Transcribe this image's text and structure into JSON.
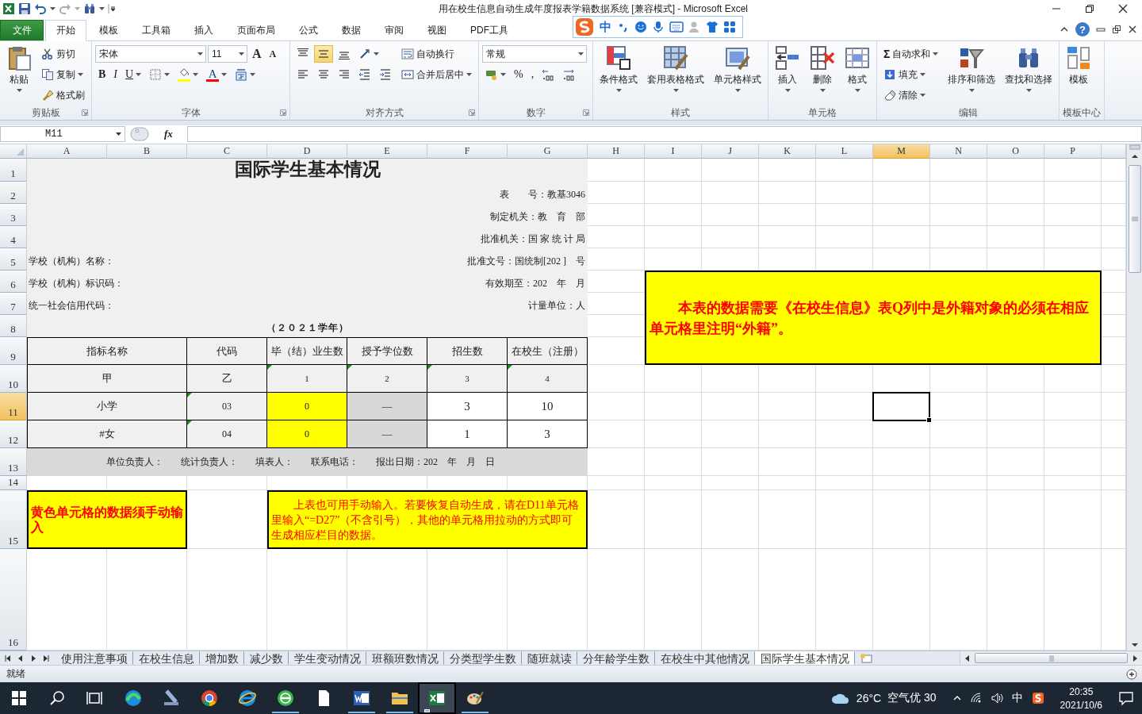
{
  "title_bar": {
    "title": "用在校生信息自动生成年度报表学籍数据系统 [兼容模式] - Microsoft Excel"
  },
  "ime_toolbar": {
    "mode": "中"
  },
  "ribbon_tabs": [
    {
      "label": "文件",
      "kind": "file",
      "selected": false
    },
    {
      "label": "开始",
      "kind": "tab",
      "selected": true
    },
    {
      "label": "模板",
      "kind": "tab",
      "selected": false
    },
    {
      "label": "工具箱",
      "kind": "tab",
      "selected": false
    },
    {
      "label": "插入",
      "kind": "tab",
      "selected": false
    },
    {
      "label": "页面布局",
      "kind": "tab",
      "selected": false
    },
    {
      "label": "公式",
      "kind": "tab",
      "selected": false
    },
    {
      "label": "数据",
      "kind": "tab",
      "selected": false
    },
    {
      "label": "审阅",
      "kind": "tab",
      "selected": false
    },
    {
      "label": "视图",
      "kind": "tab",
      "selected": false
    },
    {
      "label": "PDF工具",
      "kind": "tab",
      "selected": false
    }
  ],
  "ribbon_help": "?",
  "ribbon_groups": [
    {
      "label": "剪贴板",
      "launcher": true,
      "columns": [
        {
          "kind": "large",
          "label": "粘贴",
          "dropdown": true
        },
        {
          "kind": "stack",
          "lines": [
            {
              "controls": [
                {
                  "kind": "small",
                  "label": "剪切"
                }
              ]
            },
            {
              "controls": [
                {
                  "kind": "small",
                  "label": "复制",
                  "dropdown": true
                }
              ]
            },
            {
              "controls": [
                {
                  "kind": "small",
                  "label": "格式刷"
                }
              ]
            }
          ]
        }
      ]
    },
    {
      "label": "字体",
      "launcher": true,
      "columns": [
        {
          "kind": "stack",
          "lines": [
            {
              "controls": [
                {
                  "kind": "combo",
                  "value": "宋体"
                },
                {
                  "kind": "combo",
                  "value": "11"
                },
                {
                  "kind": "grow",
                  "text": "A"
                },
                {
                  "kind": "shrink",
                  "text": "A"
                }
              ]
            },
            {
              "controls": [
                {
                  "kind": "bold",
                  "text": "B"
                },
                {
                  "kind": "italic",
                  "text": "I"
                },
                {
                  "kind": "underline",
                  "text": "U",
                  "dropdown": true
                },
                {
                  "kind": "icon",
                  "dropdown": true
                },
                {
                  "kind": "fill-color",
                  "color": "#ffff00",
                  "dropdown": true
                },
                {
                  "kind": "font-color",
                  "text": "A",
                  "color": "#ff0000",
                  "dropdown": true
                },
                {
                  "kind": "icon",
                  "dropdown": true
                }
              ]
            }
          ]
        }
      ]
    },
    {
      "label": "对齐方式",
      "launcher": true,
      "columns": [
        {
          "kind": "stack",
          "lines": [
            {
              "controls": [
                {
                  "kind": "toggle",
                  "selected": false
                },
                {
                  "kind": "toggle",
                  "selected": true
                },
                {
                  "kind": "toggle",
                  "selected": false
                },
                {
                  "kind": "icon",
                  "dropdown": true
                }
              ]
            },
            {
              "controls": [
                {
                  "kind": "toggle",
                  "selected": false
                },
                {
                  "kind": "toggle",
                  "selected": false
                },
                {
                  "kind": "toggle",
                  "selected": false
                },
                {
                  "kind": "icon"
                },
                {
                  "kind": "icon"
                }
              ]
            }
          ]
        },
        {
          "kind": "stack",
          "lines": [
            {
              "controls": [
                {
                  "kind": "small",
                  "label": "自动换行"
                }
              ]
            },
            {
              "controls": [
                {
                  "kind": "small",
                  "label": "合并后居中",
                  "dropdown": true
                }
              ]
            }
          ]
        }
      ]
    },
    {
      "label": "数字",
      "launcher": true,
      "columns": [
        {
          "kind": "stack",
          "lines": [
            {
              "controls": [
                {
                  "kind": "combo",
                  "value": "常规"
                }
              ]
            },
            {
              "controls": [
                {
                  "kind": "icon",
                  "dropdown": true
                },
                {
                  "kind": "plain",
                  "text": "%"
                },
                {
                  "kind": "plain",
                  "text": ","
                },
                {
                  "kind": "icon"
                },
                {
                  "kind": "icon"
                }
              ]
            }
          ]
        }
      ]
    },
    {
      "label": "样式",
      "columns": [
        {
          "kind": "large",
          "label": "条件格式",
          "dropdown": true
        },
        {
          "kind": "large",
          "label": "套用表格格式",
          "dropdown": true
        },
        {
          "kind": "large",
          "label": "单元格样式",
          "dropdown": true
        }
      ]
    },
    {
      "label": "单元格",
      "columns": [
        {
          "kind": "large",
          "label": "插入",
          "dropdown": true
        },
        {
          "kind": "large",
          "label": "删除",
          "dropdown": true
        },
        {
          "kind": "large",
          "label": "格式",
          "dropdown": true
        }
      ]
    },
    {
      "label": "编辑",
      "columns": [
        {
          "kind": "stack",
          "lines": [
            {
              "controls": [
                {
                  "kind": "small",
                  "glyph": "Σ",
                  "label": "自动求和",
                  "dropdown": true
                }
              ]
            },
            {
              "controls": [
                {
                  "kind": "small",
                  "label": "填充",
                  "dropdown": true
                }
              ]
            },
            {
              "controls": [
                {
                  "kind": "small",
                  "label": "清除",
                  "dropdown": true
                }
              ]
            }
          ]
        },
        {
          "kind": "large",
          "label": "排序和筛选",
          "dropdown": true
        },
        {
          "kind": "large",
          "label": "查找和选择",
          "dropdown": true
        }
      ]
    },
    {
      "label": "模板中心",
      "columns": [
        {
          "kind": "large",
          "label": "模板"
        }
      ]
    }
  ],
  "name_box": {
    "value": "M11"
  },
  "formula_bar": {
    "function_button": "fx"
  },
  "columns": [
    {
      "label": "A",
      "selected": false
    },
    {
      "label": "B",
      "selected": false
    },
    {
      "label": "C",
      "selected": false
    },
    {
      "label": "D",
      "selected": false
    },
    {
      "label": "E",
      "selected": false
    },
    {
      "label": "F",
      "selected": false
    },
    {
      "label": "G",
      "selected": false
    },
    {
      "label": "H",
      "selected": false
    },
    {
      "label": "I",
      "selected": false
    },
    {
      "label": "J",
      "selected": false
    },
    {
      "label": "K",
      "selected": false
    },
    {
      "label": "L",
      "selected": false
    },
    {
      "label": "M",
      "selected": true
    },
    {
      "label": "N",
      "selected": false
    },
    {
      "label": "O",
      "selected": false
    },
    {
      "label": "P",
      "selected": false
    }
  ],
  "rows": [
    {
      "label": "1",
      "selected": false
    },
    {
      "label": "2",
      "selected": false
    },
    {
      "label": "3",
      "selected": false
    },
    {
      "label": "4",
      "selected": false
    },
    {
      "label": "5",
      "selected": false
    },
    {
      "label": "6",
      "selected": false
    },
    {
      "label": "7",
      "selected": false
    },
    {
      "label": "8",
      "selected": false
    },
    {
      "label": "9",
      "selected": false
    },
    {
      "label": "10",
      "selected": false
    },
    {
      "label": "11",
      "selected": true
    },
    {
      "label": "12",
      "selected": false
    },
    {
      "label": "13",
      "selected": false
    },
    {
      "label": "14",
      "selected": false
    },
    {
      "label": "15",
      "selected": false
    },
    {
      "label": "16",
      "selected": false
    }
  ],
  "sheet": {
    "title": "国际学生基本情况",
    "meta_rows": [
      {
        "right": "表　　号：教基3046"
      },
      {
        "right": "制定机关：教　育　部"
      },
      {
        "right": "批准机关：国 家 统 计 局"
      },
      {
        "left": "学校（机构）名称：",
        "right": "批准文号：国统制[202 ]　号"
      },
      {
        "left": "学校（机构）标识码：",
        "right": "有效期至：202　年　月"
      },
      {
        "left": "统一社会信用代码：",
        "right": "计量单位：人"
      }
    ],
    "year": "（２０２１学年）",
    "table": {
      "columns": [
        "指标名称",
        "代码",
        "毕（结）业生数",
        "授予学位数",
        "招生数",
        "在校生（注册）"
      ],
      "rows": [
        {
          "cells": [
            {
              "text": "甲",
              "kind": "label",
              "flag": false
            },
            {
              "text": "乙",
              "kind": "label",
              "flag": false
            },
            {
              "text": "1",
              "kind": "index",
              "flag": true
            },
            {
              "text": "2",
              "kind": "index",
              "flag": true
            },
            {
              "text": "3",
              "kind": "index",
              "flag": true
            },
            {
              "text": "4",
              "kind": "index",
              "flag": true
            }
          ]
        },
        {
          "cells": [
            {
              "text": "小学",
              "kind": "label",
              "flag": false
            },
            {
              "text": "03",
              "kind": "code",
              "flag": true
            },
            {
              "text": "0",
              "kind": "manual",
              "flag": false
            },
            {
              "text": "—",
              "kind": "blocked",
              "flag": false
            },
            {
              "text": "3",
              "kind": "value",
              "flag": false
            },
            {
              "text": "10",
              "kind": "value",
              "flag": false
            }
          ]
        },
        {
          "cells": [
            {
              "text": "#女",
              "kind": "label",
              "flag": false
            },
            {
              "text": "04",
              "kind": "code",
              "flag": true
            },
            {
              "text": "0",
              "kind": "manual",
              "flag": false
            },
            {
              "text": "—",
              "kind": "blocked",
              "flag": false
            },
            {
              "text": "1",
              "kind": "value",
              "flag": false
            },
            {
              "text": "3",
              "kind": "value",
              "flag": false
            }
          ]
        }
      ]
    },
    "footer": [
      "单位负责人：",
      "统计负责人：",
      "填表人：",
      "联系电话：",
      "报出日期：202　年　月　日"
    ],
    "notes": [
      {
        "text": "黄色单元格的数据须手动输入"
      },
      {
        "text": "上表也可用手动输入。若要恢复自动生成，请在D11单元格里输入“=D27”（不含引号），其他的单元格用拉动的方式即可生成相应栏目的数据。"
      }
    ],
    "callout": "本表的数据需要《在校生信息》表Q列中是外籍对象的必须在相应单元格里注明“外籍”。"
  },
  "sheet_tabs": [
    {
      "label": "使用注意事项",
      "selected": false
    },
    {
      "label": "在校生信息",
      "selected": false
    },
    {
      "label": "增加数",
      "selected": false
    },
    {
      "label": "减少数",
      "selected": false
    },
    {
      "label": "学生变动情况",
      "selected": false
    },
    {
      "label": "班额班数情况",
      "selected": false
    },
    {
      "label": "分类型学生数",
      "selected": false
    },
    {
      "label": "随班就读",
      "selected": false
    },
    {
      "label": "分年龄学生数",
      "selected": false
    },
    {
      "label": "在校生中其他情况",
      "selected": false
    },
    {
      "label": "国际学生基本情况",
      "selected": true
    }
  ],
  "status_bar": {
    "text": "就绪"
  },
  "taskbar": {
    "apps": [
      {
        "running": false,
        "active": false
      },
      {
        "running": false,
        "active": false
      },
      {
        "running": false,
        "active": false
      },
      {
        "running": false,
        "active": false
      },
      {
        "running": true,
        "active": false
      },
      {
        "running": false,
        "active": false
      },
      {
        "running": true,
        "active": false
      },
      {
        "running": true,
        "active": false
      },
      {
        "running": true,
        "active": true
      },
      {
        "running": true,
        "active": false
      }
    ],
    "weather": {
      "temperature": "26°C",
      "air_quality": "空气优 30"
    },
    "input_method": "中",
    "clock": {
      "time": "20:35",
      "date": "2021/10/6"
    }
  }
}
